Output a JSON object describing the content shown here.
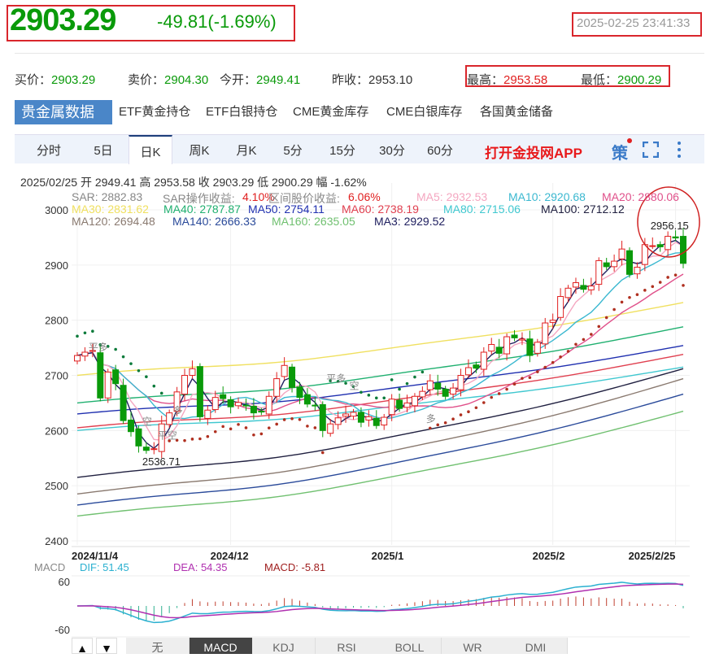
{
  "quote": {
    "price": "2903.29",
    "change": "-49.81(-1.69%)",
    "time": "2025-02-25 23:41:33"
  },
  "stats": [
    {
      "label": "买价：",
      "value": "2903.29",
      "color": "g"
    },
    {
      "label": "卖价：",
      "value": "2904.30",
      "color": "g"
    },
    {
      "label": "今开：",
      "value": "2949.41",
      "color": "g"
    },
    {
      "label": "昨收：",
      "value": "2953.10",
      "color": ""
    },
    {
      "label": "最高：",
      "value": "2953.58",
      "color": "r"
    },
    {
      "label": "最低：",
      "value": "2900.29",
      "color": "g"
    }
  ],
  "tabs": [
    "贵金属数据",
    "ETF黄金持仓",
    "ETF白银持仓",
    "CME黄金库存",
    "CME白银库存",
    "各国黄金储备"
  ],
  "periods": [
    "分时",
    "5日",
    "日K",
    "周K",
    "月K",
    "5分",
    "15分",
    "30分",
    "60分"
  ],
  "active_period": 2,
  "app_link": "打开金投网APP",
  "strategy_icon_label": "策",
  "ohlc_line": "2025/02/25  开 2949.41  高 2953.58  收 2903.29  低 2900.29  幅 -1.62%",
  "indicators": [
    [
      {
        "t": "SAR: 2882.83",
        "c": "#888"
      },
      {
        "t": "SAR操作收益: ",
        "c": "#888"
      },
      {
        "t": "4.10%",
        "c": "#e02020"
      },
      {
        "t": "区间股价收益: ",
        "c": "#888"
      },
      {
        "t": "6.06%",
        "c": "#e02020"
      },
      {
        "t": "MA5: 2932.53",
        "c": "#f4a6c0"
      },
      {
        "t": "MA10: 2920.68",
        "c": "#3bb8d0"
      },
      {
        "t": "MA20: 2880.06",
        "c": "#e0508a"
      }
    ],
    [
      {
        "t": "MA30: 2831.62",
        "c": "#f0e060"
      },
      {
        "t": "MA40: 2787.87",
        "c": "#20b070"
      },
      {
        "t": "MA50: 2754.11",
        "c": "#2030b0"
      },
      {
        "t": "MA60: 2738.19",
        "c": "#e04050"
      },
      {
        "t": "MA80: 2715.06",
        "c": "#40c8d0"
      },
      {
        "t": "MA100: 2712.12",
        "c": "#202040"
      }
    ],
    [
      {
        "t": "MA120: 2694.48",
        "c": "#8a7a70"
      },
      {
        "t": "MA140: 2666.33",
        "c": "#2a4a9a"
      },
      {
        "t": "MA160: 2635.05",
        "c": "#70c070"
      },
      {
        "t": "MA3: 2929.52",
        "c": "#202060"
      }
    ]
  ],
  "colors": {
    "up": "#e02020",
    "down": "#0a9a0a",
    "sar": "#0a7a3a",
    "sar_low": "#b03020"
  },
  "chart_data": {
    "type": "candlestick",
    "yticks": [
      "3000",
      "2900",
      "2800",
      "2700",
      "2600",
      "2500",
      "2400"
    ],
    "ylim": [
      2400,
      3000
    ],
    "xlabels": [
      {
        "t": "2024/11/4",
        "i": 0
      },
      {
        "t": "2024/12",
        "i": 20
      },
      {
        "t": "2025/1",
        "i": 41
      },
      {
        "t": "2025/2",
        "i": 62
      },
      {
        "t": "2025/2/25",
        "i": 78
      }
    ],
    "closes": [
      2736,
      2742,
      2745,
      2659,
      2706,
      2685,
      2618,
      2598,
      2572,
      2564,
      2567,
      2612,
      2632,
      2670,
      2700,
      2712,
      2625,
      2637,
      2660,
      2658,
      2643,
      2651,
      2645,
      2632,
      2634,
      2662,
      2694,
      2718,
      2678,
      2660,
      2648,
      2645,
      2600,
      2612,
      2623,
      2630,
      2633,
      2615,
      2625,
      2609,
      2624,
      2657,
      2640,
      2650,
      2662,
      2671,
      2690,
      2675,
      2662,
      2677,
      2700,
      2714,
      2713,
      2742,
      2756,
      2740,
      2770,
      2768,
      2766,
      2736,
      2760,
      2795,
      2800,
      2843,
      2858,
      2868,
      2856,
      2862,
      2908,
      2897,
      2907,
      2929,
      2883,
      2896,
      2937,
      2935,
      2933,
      2952,
      2949,
      2903
    ],
    "annotations": [
      {
        "t": "2956.15",
        "i": 76,
        "p": 2956
      },
      {
        "t": "2536.71",
        "i": 9,
        "p": 2537
      },
      {
        "t": "平多",
        "i": 2,
        "p": 2745
      },
      {
        "t": "空",
        "i": 9,
        "p": 2610
      },
      {
        "t": "多",
        "i": 13,
        "p": 2630
      },
      {
        "t": "平空",
        "i": 11,
        "p": 2585
      },
      {
        "t": "平多",
        "i": 33,
        "p": 2688
      },
      {
        "t": "空",
        "i": 36,
        "p": 2675
      },
      {
        "t": "多",
        "i": 46,
        "p": 2615
      }
    ],
    "long_mas": [
      {
        "c": "#f0e060",
        "s": 2700,
        "e": 2832
      },
      {
        "c": "#20b070",
        "s": 2650,
        "e": 2788
      },
      {
        "c": "#2030b0",
        "s": 2630,
        "e": 2754
      },
      {
        "c": "#e04050",
        "s": 2605,
        "e": 2738
      },
      {
        "c": "#40c8d0",
        "s": 2600,
        "e": 2715
      },
      {
        "c": "#202040",
        "s": 2515,
        "e": 2712
      },
      {
        "c": "#8a7a70",
        "s": 2485,
        "e": 2694
      },
      {
        "c": "#2a4a9a",
        "s": 2465,
        "e": 2666
      },
      {
        "c": "#70c070",
        "s": 2445,
        "e": 2635
      }
    ],
    "macd": {
      "label": "MACD",
      "dif": "DIF: 51.45",
      "dea": "DEA: 54.35",
      "macd": "MACD: -5.81",
      "yticks": [
        "60",
        "-60"
      ]
    }
  },
  "bottom": {
    "up": "▲",
    "down": "▼",
    "tabs": [
      "无",
      "MACD",
      "KDJ",
      "RSI",
      "BOLL",
      "WR",
      "DMI"
    ],
    "active": 1
  }
}
